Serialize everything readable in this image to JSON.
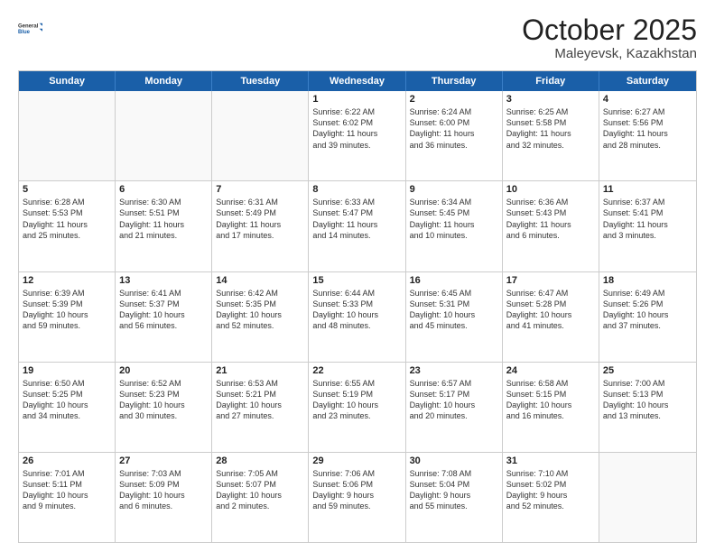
{
  "logo": {
    "line1": "General",
    "line2": "Blue"
  },
  "title": "October 2025",
  "location": "Maleyevsk, Kazakhstan",
  "header_days": [
    "Sunday",
    "Monday",
    "Tuesday",
    "Wednesday",
    "Thursday",
    "Friday",
    "Saturday"
  ],
  "weeks": [
    [
      {
        "day": "",
        "info": ""
      },
      {
        "day": "",
        "info": ""
      },
      {
        "day": "",
        "info": ""
      },
      {
        "day": "1",
        "info": "Sunrise: 6:22 AM\nSunset: 6:02 PM\nDaylight: 11 hours\nand 39 minutes."
      },
      {
        "day": "2",
        "info": "Sunrise: 6:24 AM\nSunset: 6:00 PM\nDaylight: 11 hours\nand 36 minutes."
      },
      {
        "day": "3",
        "info": "Sunrise: 6:25 AM\nSunset: 5:58 PM\nDaylight: 11 hours\nand 32 minutes."
      },
      {
        "day": "4",
        "info": "Sunrise: 6:27 AM\nSunset: 5:56 PM\nDaylight: 11 hours\nand 28 minutes."
      }
    ],
    [
      {
        "day": "5",
        "info": "Sunrise: 6:28 AM\nSunset: 5:53 PM\nDaylight: 11 hours\nand 25 minutes."
      },
      {
        "day": "6",
        "info": "Sunrise: 6:30 AM\nSunset: 5:51 PM\nDaylight: 11 hours\nand 21 minutes."
      },
      {
        "day": "7",
        "info": "Sunrise: 6:31 AM\nSunset: 5:49 PM\nDaylight: 11 hours\nand 17 minutes."
      },
      {
        "day": "8",
        "info": "Sunrise: 6:33 AM\nSunset: 5:47 PM\nDaylight: 11 hours\nand 14 minutes."
      },
      {
        "day": "9",
        "info": "Sunrise: 6:34 AM\nSunset: 5:45 PM\nDaylight: 11 hours\nand 10 minutes."
      },
      {
        "day": "10",
        "info": "Sunrise: 6:36 AM\nSunset: 5:43 PM\nDaylight: 11 hours\nand 6 minutes."
      },
      {
        "day": "11",
        "info": "Sunrise: 6:37 AM\nSunset: 5:41 PM\nDaylight: 11 hours\nand 3 minutes."
      }
    ],
    [
      {
        "day": "12",
        "info": "Sunrise: 6:39 AM\nSunset: 5:39 PM\nDaylight: 10 hours\nand 59 minutes."
      },
      {
        "day": "13",
        "info": "Sunrise: 6:41 AM\nSunset: 5:37 PM\nDaylight: 10 hours\nand 56 minutes."
      },
      {
        "day": "14",
        "info": "Sunrise: 6:42 AM\nSunset: 5:35 PM\nDaylight: 10 hours\nand 52 minutes."
      },
      {
        "day": "15",
        "info": "Sunrise: 6:44 AM\nSunset: 5:33 PM\nDaylight: 10 hours\nand 48 minutes."
      },
      {
        "day": "16",
        "info": "Sunrise: 6:45 AM\nSunset: 5:31 PM\nDaylight: 10 hours\nand 45 minutes."
      },
      {
        "day": "17",
        "info": "Sunrise: 6:47 AM\nSunset: 5:28 PM\nDaylight: 10 hours\nand 41 minutes."
      },
      {
        "day": "18",
        "info": "Sunrise: 6:49 AM\nSunset: 5:26 PM\nDaylight: 10 hours\nand 37 minutes."
      }
    ],
    [
      {
        "day": "19",
        "info": "Sunrise: 6:50 AM\nSunset: 5:25 PM\nDaylight: 10 hours\nand 34 minutes."
      },
      {
        "day": "20",
        "info": "Sunrise: 6:52 AM\nSunset: 5:23 PM\nDaylight: 10 hours\nand 30 minutes."
      },
      {
        "day": "21",
        "info": "Sunrise: 6:53 AM\nSunset: 5:21 PM\nDaylight: 10 hours\nand 27 minutes."
      },
      {
        "day": "22",
        "info": "Sunrise: 6:55 AM\nSunset: 5:19 PM\nDaylight: 10 hours\nand 23 minutes."
      },
      {
        "day": "23",
        "info": "Sunrise: 6:57 AM\nSunset: 5:17 PM\nDaylight: 10 hours\nand 20 minutes."
      },
      {
        "day": "24",
        "info": "Sunrise: 6:58 AM\nSunset: 5:15 PM\nDaylight: 10 hours\nand 16 minutes."
      },
      {
        "day": "25",
        "info": "Sunrise: 7:00 AM\nSunset: 5:13 PM\nDaylight: 10 hours\nand 13 minutes."
      }
    ],
    [
      {
        "day": "26",
        "info": "Sunrise: 7:01 AM\nSunset: 5:11 PM\nDaylight: 10 hours\nand 9 minutes."
      },
      {
        "day": "27",
        "info": "Sunrise: 7:03 AM\nSunset: 5:09 PM\nDaylight: 10 hours\nand 6 minutes."
      },
      {
        "day": "28",
        "info": "Sunrise: 7:05 AM\nSunset: 5:07 PM\nDaylight: 10 hours\nand 2 minutes."
      },
      {
        "day": "29",
        "info": "Sunrise: 7:06 AM\nSunset: 5:06 PM\nDaylight: 9 hours\nand 59 minutes."
      },
      {
        "day": "30",
        "info": "Sunrise: 7:08 AM\nSunset: 5:04 PM\nDaylight: 9 hours\nand 55 minutes."
      },
      {
        "day": "31",
        "info": "Sunrise: 7:10 AM\nSunset: 5:02 PM\nDaylight: 9 hours\nand 52 minutes."
      },
      {
        "day": "",
        "info": ""
      }
    ]
  ]
}
